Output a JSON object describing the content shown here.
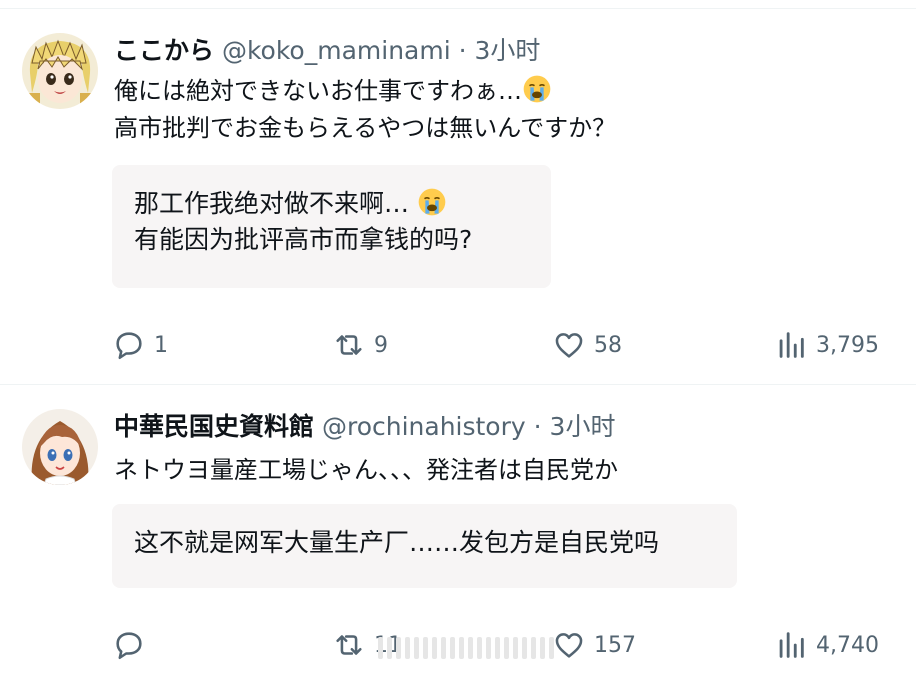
{
  "tweets": [
    {
      "display_name": "ここから",
      "handle": "@koko_maminami",
      "separator": "·",
      "time": "3小时",
      "text_line1": "俺には絶対できないお仕事ですわぁ…",
      "text_line2": "高市批判でお金もらえるやつは無いんですか？",
      "emoji": "crying-face-emoji",
      "translation_line1": "那工作我绝对做不来啊…",
      "translation_line2": "有能因为批评高市而拿钱的吗?",
      "replies": "1",
      "retweets": "9",
      "likes": "58",
      "views": "3,795"
    },
    {
      "display_name": "中華民国史資料館",
      "handle": "@rochinahistory",
      "separator": "·",
      "time": "3小时",
      "text_line1": "ネトウヨ量産工場じゃん、、、発注者は自民党か",
      "translation_line1": "这不就是网军大量生产厂……发包方是自民党吗",
      "replies": "",
      "retweets": "11",
      "likes": "157",
      "views": "4,740"
    }
  ],
  "colors": {
    "text_primary": "#0f1419",
    "text_secondary": "#536471",
    "translation_bg": "#f7f5f5",
    "divider": "#eff3f4"
  }
}
